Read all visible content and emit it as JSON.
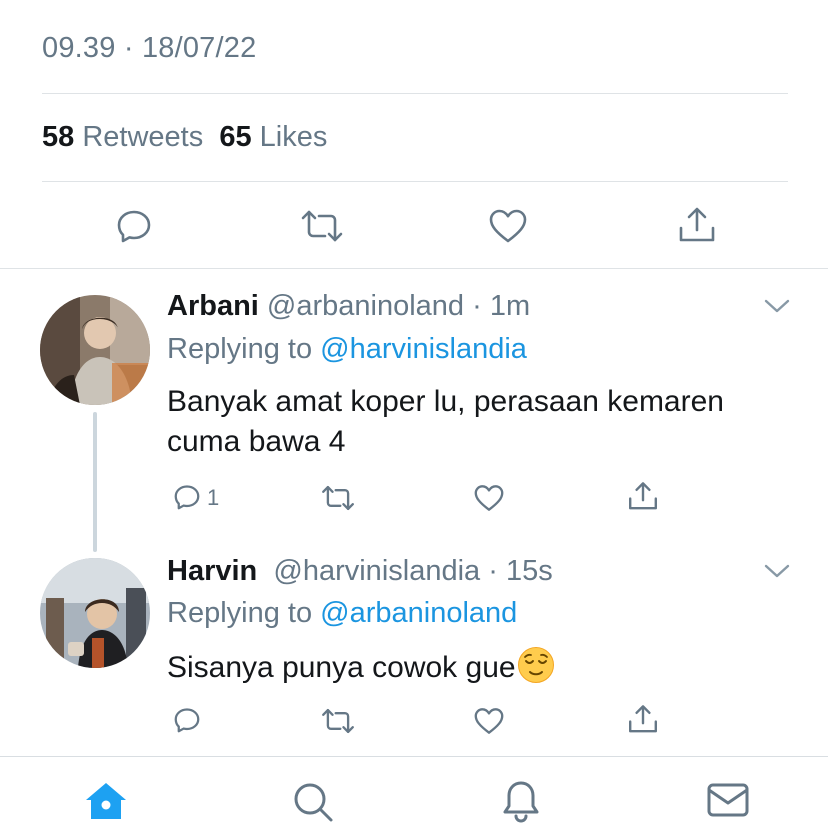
{
  "tweet": {
    "timestamp": "09.39 · 18/07/22",
    "retweet_count": "58",
    "retweet_label": "Retweets",
    "like_count": "65",
    "like_label": "Likes"
  },
  "replies": [
    {
      "name": "Arbani",
      "handle": "@arbaninoland",
      "time": "1m",
      "replying_prefix": "Replying to",
      "replying_handle": "@harvinislandia",
      "text": "Banyak amat koper lu, perasaan kemaren cuma bawa 4",
      "reply_count": "1"
    },
    {
      "name": "Harvin",
      "handle": "@harvinislandia",
      "time": "15s",
      "replying_prefix": "Replying to",
      "replying_handle": "@arbaninoland",
      "text": "Sisanya punya cowok gue",
      "emoji": "relieved-face"
    }
  ],
  "icons": {
    "reply": "reply-icon",
    "retweet": "retweet-icon",
    "like": "heart-icon",
    "share": "share-icon",
    "caret": "chevron-down-icon",
    "home": "home-icon",
    "search": "search-icon",
    "notifications": "bell-icon",
    "messages": "mail-icon"
  },
  "colors": {
    "accent": "#1da1f2",
    "link": "#1b95e0",
    "secondary_text": "#657786",
    "divider": "#dfe3e6",
    "thread_line": "#ccd6dd"
  }
}
